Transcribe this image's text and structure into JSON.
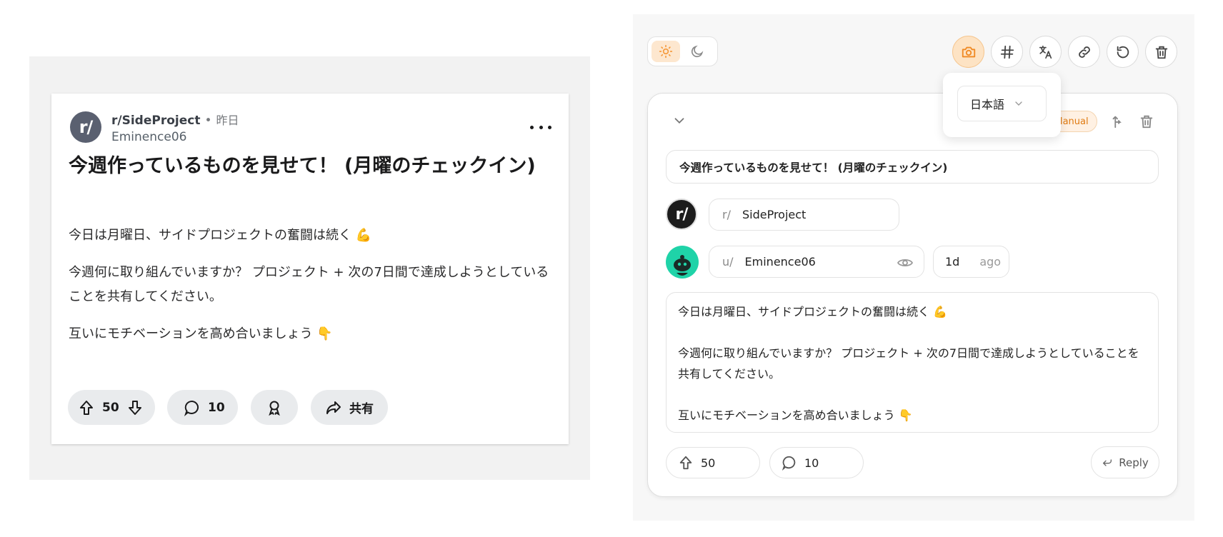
{
  "preview": {
    "avatar_text": "r/",
    "subreddit": "r/SideProject",
    "separator": "•",
    "time": "昨日",
    "username": "Eminence06",
    "title": "今週作っているものを見せて！ (月曜のチェックイン)",
    "body": [
      "今日は月曜日、サイドプロジェクトの奮闘は続く 💪",
      "今週何に取り組んでいますか？ プロジェクト + 次の7日間で達成しようとしていることを共有してください。",
      "互いにモチベーションを高め合いましょう 👇"
    ],
    "votes": "50",
    "comments": "10",
    "share_label": "共有"
  },
  "editor": {
    "language": "日本語",
    "manual_badge": "Manual",
    "title": "今週作っているものを見せて！ (月曜のチェックイン)",
    "avatar_text": "r/",
    "subreddit_prefix": "r/",
    "subreddit": "SideProject",
    "user_prefix": "u/",
    "username": "Eminence06",
    "time_value": "1d",
    "time_suffix": "ago",
    "body": [
      "今日は月曜日、サイドプロジェクトの奮闘は続く 💪",
      "今週何に取り組んでいますか？ プロジェクト + 次の7日間で達成しようとしていることを共有してください。",
      "互いにモチベーションを高め合いましょう 👇"
    ],
    "votes": "50",
    "comments": "10",
    "reply_label": "Reply"
  },
  "colors": {
    "accent": "#f59a3c",
    "accent_bg": "#fde3c4",
    "preview_bg": "#f2f2f2"
  },
  "icons": [
    "sun-icon",
    "moon-icon",
    "camera-icon",
    "hash-icon",
    "translate-icon",
    "link-icon",
    "reset-icon",
    "trash-icon",
    "chevron-down-icon",
    "eye-icon",
    "upvote-icon",
    "downvote-icon",
    "comment-icon",
    "award-icon",
    "share-icon",
    "reply-icon"
  ]
}
